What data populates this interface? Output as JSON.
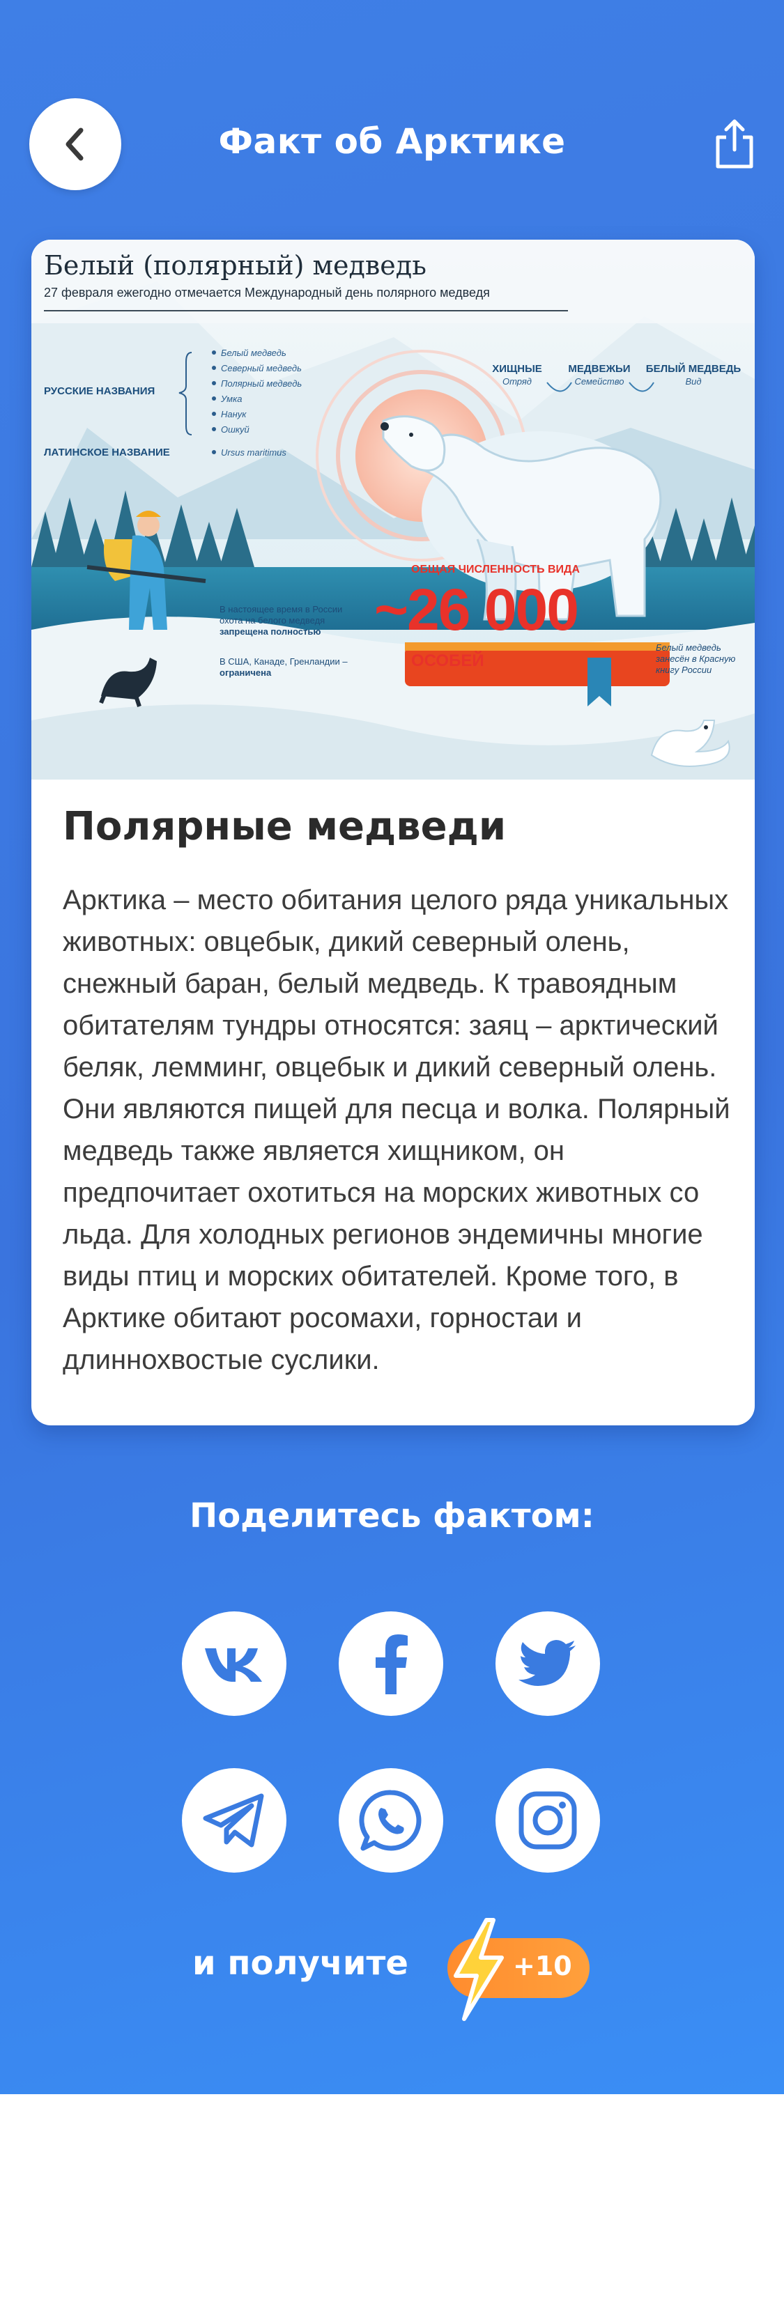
{
  "header": {
    "title": "Факт об Арктике",
    "back_icon": "chevron-left-icon",
    "share_icon": "share-icon"
  },
  "infographic": {
    "title": "Белый (полярный) медведь",
    "subtitle": "27 февраля ежегодно отмечается Международный день полярного медведя",
    "russian_names_label": "РУССКИЕ НАЗВАНИЯ",
    "russian_names": [
      "Белый медведь",
      "Северный медведь",
      "Полярный медведь",
      "Умка",
      "Нанук",
      "Ошкуй"
    ],
    "latin_label": "ЛАТИНСКОЕ НАЗВАНИЕ",
    "latin_name": "Ursus maritimus",
    "taxonomy": [
      {
        "title": "ХИЩНЫЕ",
        "sub": "Отряд"
      },
      {
        "title": "МЕДВЕЖЬИ",
        "sub": "Семейство"
      },
      {
        "title": "БЕЛЫЙ МЕДВЕДЬ",
        "sub": "Вид"
      }
    ],
    "population_label": "ОБЩАЯ ЧИСЛЕННОСТЬ ВИДА",
    "population_value": "~26 000",
    "population_unit": "ОСОБЕЙ",
    "hunting_note_lines": [
      "В настоящее время в России",
      "охота на белого медведя",
      "запрещена полностью"
    ],
    "usa_note_lines": [
      "В США, Канаде, Гренландии –",
      "ограничена"
    ],
    "redbook_note_lines": [
      "Белый медведь",
      "занесён в Красную",
      "книгу России"
    ]
  },
  "card": {
    "title": "Полярные медведи",
    "text": "Арктика – место обитания целого ряда уникальных животных: овцебык, дикий северный олень, снежный баран, белый медведь. К травоядным обитателям тундры относятся: заяц – арктический беляк, лемминг, овцебык и дикий северный олень. Они являются пищей для песца и волка. Полярный медведь также является хищником, он предпочитает охотиться на морских животных со льда. Для холодных регионов эндемичны многие виды птиц и морских обитателей. Кроме того, в Арктике обитают росомахи, горностаи и длиннохвостые суслики."
  },
  "share": {
    "heading": "Поделитесь фактом:",
    "networks": [
      "vk-icon",
      "facebook-icon",
      "twitter-icon",
      "telegram-icon",
      "whatsapp-icon",
      "instagram-icon"
    ],
    "reward_label": "и получите",
    "reward_value": "+10",
    "reward_icon": "lightning-icon"
  },
  "colors": {
    "background_top": "#3f7fe6",
    "background_bottom": "#3a8ef5",
    "icon_blue": "#3a7be0",
    "reward_orange": "#ff9a38",
    "bolt_yellow": "#ffd23a"
  }
}
